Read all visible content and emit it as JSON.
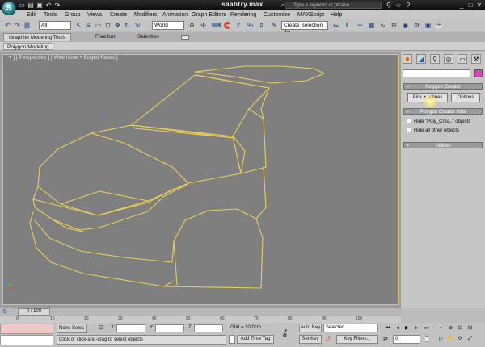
{
  "titlebar": {
    "title": "saabtry.max",
    "search_placeholder": "Type a keyword or phrase"
  },
  "menu": {
    "items": [
      "Edit",
      "Tools",
      "Group",
      "Views",
      "Create",
      "Modifiers",
      "Animation",
      "Graph Editors",
      "Rendering",
      "Customize",
      "MAXScript",
      "Help"
    ]
  },
  "toolbar": {
    "selection_filter": "All",
    "coord_system": "World",
    "named_selection": "Create Selection Se"
  },
  "ribbon": {
    "tabs": [
      "Graphite Modeling Tools",
      "Freeform",
      "Selection"
    ],
    "sub_panel": "Polygon Modeling"
  },
  "viewport": {
    "label": "[ + ] [ Perspective ] [ Wireframe + Edged Faces ]",
    "wire_color": "#e8cf5a"
  },
  "command_panel": {
    "rollouts": {
      "polygon_creator": "Polygon Creator",
      "polygon_creator_hide": "Polygon Creator Hide",
      "utilities": "Utilities"
    },
    "buttons": {
      "pick_splines": "Pick + splines",
      "options": "Options"
    },
    "checks": {
      "hide_poly": "Hide \"Poly_Crea..\" objects",
      "hide_all": "Hide all other objects"
    },
    "swatch_color": "#e040c0"
  },
  "timeline": {
    "handle": "0 / 100",
    "ticks": [
      "0",
      "10",
      "20",
      "30",
      "40",
      "50",
      "60",
      "70",
      "80",
      "90",
      "100"
    ]
  },
  "status": {
    "selection": "None Selec",
    "prompt": "Click or click-and-drag to select objects",
    "x_label": "X:",
    "y_label": "Y:",
    "z_label": "Z:",
    "grid": "Grid = 10,0cm",
    "add_time_tag": "Add Time Tag",
    "auto_key": "Auto Key",
    "set_key": "Set Key",
    "key_mode": "Selected",
    "key_filters": "Key Filters...",
    "frame": "0"
  }
}
